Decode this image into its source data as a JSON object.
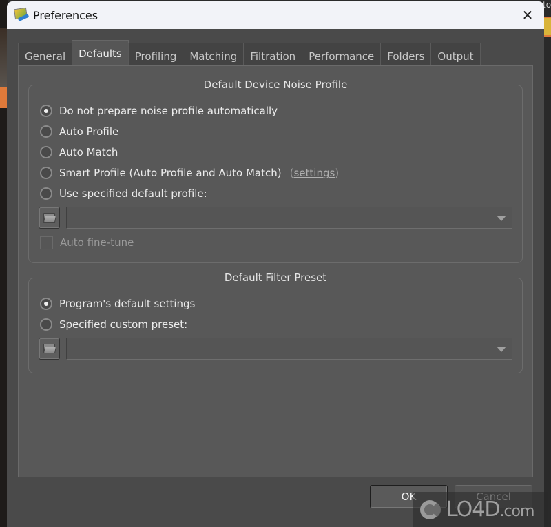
{
  "window": {
    "title": "Preferences",
    "close_icon": "close-x-icon"
  },
  "tabs": [
    {
      "label": "General",
      "active": false
    },
    {
      "label": "Defaults",
      "active": true
    },
    {
      "label": "Profiling",
      "active": false
    },
    {
      "label": "Matching",
      "active": false
    },
    {
      "label": "Filtration",
      "active": false
    },
    {
      "label": "Performance",
      "active": false
    },
    {
      "label": "Folders",
      "active": false
    },
    {
      "label": "Output",
      "active": false
    }
  ],
  "noise_profile_group": {
    "title": "Default Device Noise Profile",
    "options": [
      {
        "label": "Do not prepare noise profile automatically",
        "checked": true
      },
      {
        "label": "Auto Profile",
        "checked": false
      },
      {
        "label": "Auto Match",
        "checked": false
      },
      {
        "label": "Smart Profile (Auto Profile and Auto Match)",
        "checked": false
      },
      {
        "label": "Use specified default profile:",
        "checked": false
      }
    ],
    "settings_link": {
      "open": "(",
      "label": "settings",
      "close": ")"
    },
    "profile_combo_value": "",
    "auto_fine_tune": {
      "label": "Auto fine-tune",
      "checked": false,
      "enabled": false
    }
  },
  "filter_preset_group": {
    "title": "Default Filter Preset",
    "options": [
      {
        "label": "Program's default settings",
        "checked": true
      },
      {
        "label": "Specified custom preset:",
        "checked": false
      }
    ],
    "preset_combo_value": ""
  },
  "buttons": {
    "ok": "OK",
    "cancel": "Cancel"
  },
  "watermark": {
    "brand": "LO4D",
    "suffix": ".com"
  },
  "background": {
    "right_edge_text": "to"
  }
}
